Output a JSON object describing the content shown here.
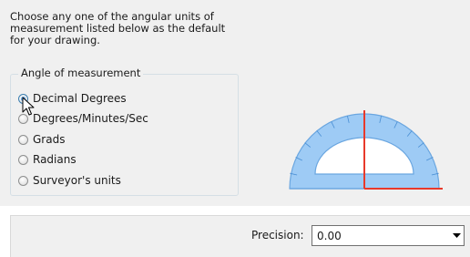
{
  "instructions": {
    "line1": "Choose any one of the angular units of",
    "line2": "measurement listed below as the default",
    "line3": "for your drawing."
  },
  "angle_group": {
    "legend": "Angle of measurement",
    "options": [
      {
        "label": "Decimal Degrees",
        "checked": true
      },
      {
        "label": "Degrees/Minutes/Sec",
        "checked": false
      },
      {
        "label": "Grads",
        "checked": false
      },
      {
        "label": "Radians",
        "checked": false
      },
      {
        "label": "Surveyor's units",
        "checked": false
      }
    ]
  },
  "precision": {
    "label": "Precision:",
    "value": "0.00"
  },
  "colors": {
    "panel_bg": "#f0f0f0",
    "protractor_fill": "#9ecbf5",
    "protractor_stroke": "#6aa6e0",
    "axis_red": "#e8392b",
    "radio_checked": "#2a7bd1"
  },
  "icons": {
    "cursor": "arrow-cursor-icon",
    "dropdown": "chevron-down-icon",
    "preview": "protractor-icon"
  }
}
